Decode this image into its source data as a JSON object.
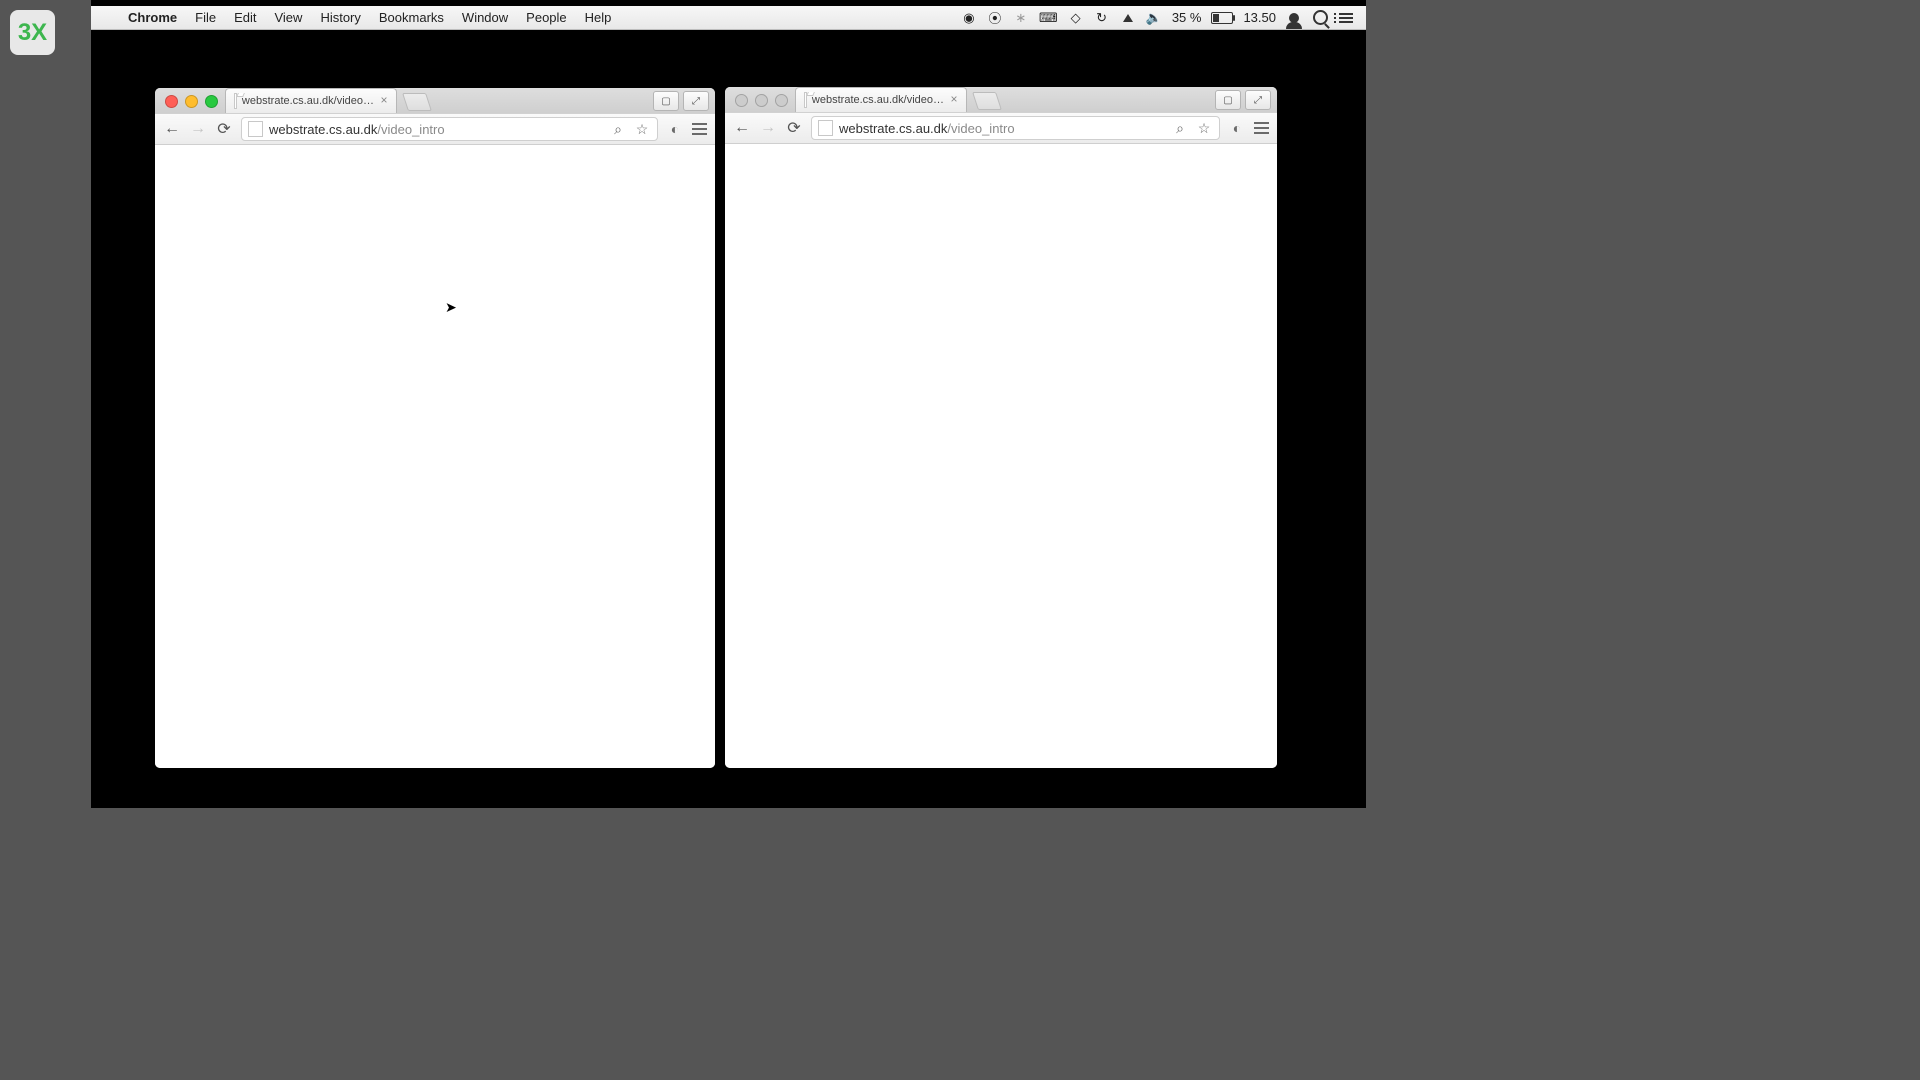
{
  "badge": {
    "label": "3X",
    "color": "#3db64e"
  },
  "menubar": {
    "app": "Chrome",
    "menus": [
      "File",
      "Edit",
      "View",
      "History",
      "Bookmarks",
      "Window",
      "People",
      "Help"
    ],
    "status": {
      "battery_percent": "35 %",
      "clock": "13.50"
    }
  },
  "windows": [
    {
      "id": "left",
      "active": true,
      "tab_title": "webstrate.cs.au.dk/video…",
      "url_host": "webstrate.cs.au.dk",
      "url_path": "/video_intro",
      "cursor_shown": true
    },
    {
      "id": "right",
      "active": false,
      "tab_title": "webstrate.cs.au.dk/video…",
      "url_host": "webstrate.cs.au.dk",
      "url_path": "/video_intro",
      "cursor_shown": false
    }
  ],
  "icons": {
    "close": "close-icon",
    "minimize": "minimize-icon",
    "maximize": "maximize-icon",
    "back": "◀",
    "forward": "▶",
    "reload": "⟳",
    "zoom": "🔍",
    "star": "☆",
    "profile": "👤",
    "fullscreen": "⤢",
    "menu": "≡"
  }
}
